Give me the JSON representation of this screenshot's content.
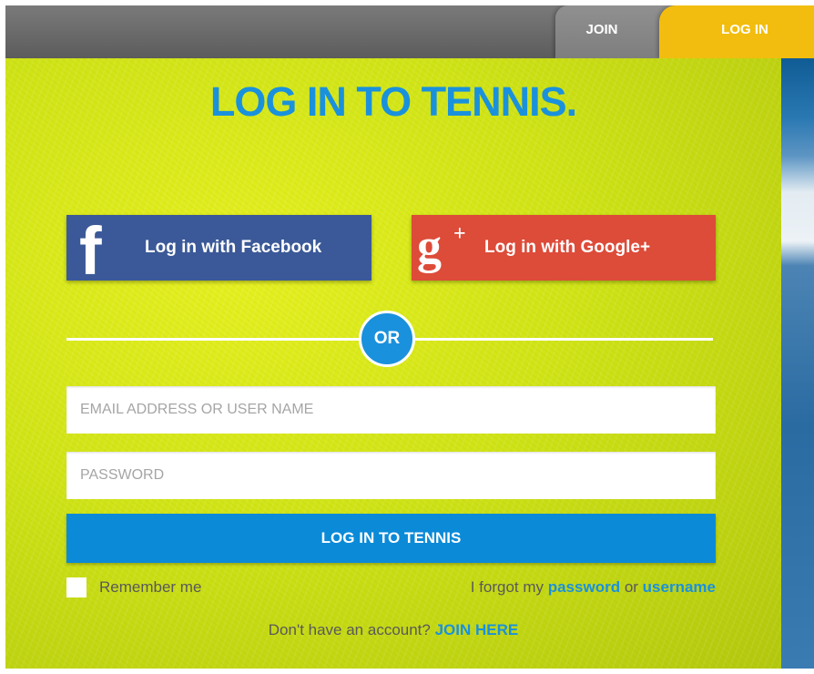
{
  "header": {
    "join_tab": "JOIN",
    "login_tab": "LOG IN"
  },
  "main": {
    "title": "LOG IN TO TENNIS.",
    "facebook_button": {
      "icon": "facebook-icon",
      "glyph": "f",
      "label": "Log in with Facebook"
    },
    "google_button": {
      "icon": "google-plus-icon",
      "glyph": "g",
      "glyph_plus": "+",
      "label": "Log in with Google+"
    },
    "or_label": "OR",
    "email_field": {
      "placeholder": "EMAIL ADDRESS OR USER NAME",
      "value": ""
    },
    "password_field": {
      "placeholder": "PASSWORD",
      "value": ""
    },
    "submit_label": "LOG IN TO TENNIS",
    "remember_label": "Remember me",
    "remember_checked": false,
    "forgot": {
      "prefix": "I forgot my ",
      "password_link": "password",
      "middle": " or ",
      "username_link": "username"
    },
    "signup": {
      "prefix": "Don't have an account? ",
      "link": "JOIN HERE"
    }
  },
  "colors": {
    "accent_blue": "#1a91dc",
    "login_tab": "#f2bd0e",
    "facebook": "#3b5998",
    "google": "#dd4b39",
    "topbar": "#6b6b6b"
  }
}
